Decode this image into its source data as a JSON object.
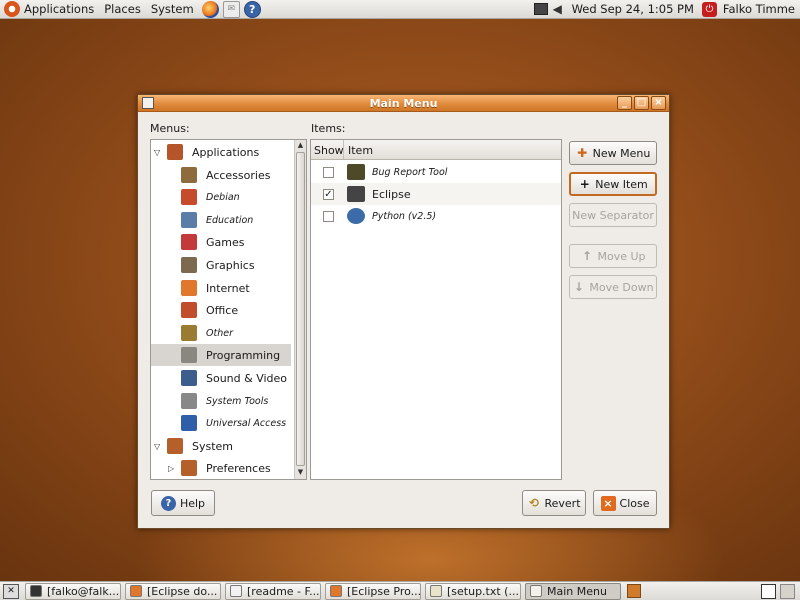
{
  "top_panel": {
    "menus": [
      "Applications",
      "Places",
      "System"
    ],
    "clock": "Wed Sep 24,  1:05 PM",
    "user": "Falko Timme",
    "launchers": [
      "firefox-icon",
      "mail-icon",
      "help-icon"
    ]
  },
  "dialog": {
    "title": "Main Menu",
    "menus_label": "Menus:",
    "items_label": "Items:",
    "tree": [
      {
        "label": "Applications",
        "level": 0,
        "expanded": true,
        "italic": false,
        "icon": "applications-icon",
        "color": "#b5562a"
      },
      {
        "label": "Accessories",
        "level": 1,
        "italic": false,
        "icon": "accessories-icon",
        "color": "#8d6b3d"
      },
      {
        "label": "Debian",
        "level": 1,
        "italic": true,
        "icon": "debian-icon",
        "color": "#c64b2b"
      },
      {
        "label": "Education",
        "level": 1,
        "italic": true,
        "icon": "education-icon",
        "color": "#5a7ea8"
      },
      {
        "label": "Games",
        "level": 1,
        "italic": false,
        "icon": "games-icon",
        "color": "#c23a3a"
      },
      {
        "label": "Graphics",
        "level": 1,
        "italic": false,
        "icon": "graphics-icon",
        "color": "#7d6a4e"
      },
      {
        "label": "Internet",
        "level": 1,
        "italic": false,
        "icon": "internet-icon",
        "color": "#e0772a"
      },
      {
        "label": "Office",
        "level": 1,
        "italic": false,
        "icon": "office-icon",
        "color": "#c04d2c"
      },
      {
        "label": "Other",
        "level": 1,
        "italic": true,
        "icon": "other-icon",
        "color": "#9a7b32"
      },
      {
        "label": "Programming",
        "level": 1,
        "italic": false,
        "selected": true,
        "icon": "programming-icon",
        "color": "#8a8780"
      },
      {
        "label": "Sound & Video",
        "level": 1,
        "italic": false,
        "icon": "sound-video-icon",
        "color": "#3d5e8c"
      },
      {
        "label": "System Tools",
        "level": 1,
        "italic": true,
        "icon": "system-tools-icon",
        "color": "#888888"
      },
      {
        "label": "Universal Access",
        "level": 1,
        "italic": true,
        "icon": "universal-access-icon",
        "color": "#2f5fa8"
      },
      {
        "label": "System",
        "level": 0,
        "expanded": true,
        "italic": false,
        "icon": "system-icon",
        "color": "#b55f2a"
      },
      {
        "label": "Preferences",
        "level": 1,
        "collapsed": true,
        "italic": false,
        "icon": "preferences-icon",
        "color": "#b55f2a"
      }
    ],
    "columns": {
      "show": "Show",
      "item": "Item"
    },
    "items": [
      {
        "label": "Bug Report Tool",
        "checked": false,
        "italic": true,
        "icon": "bug-icon",
        "color": "#4d4a2a"
      },
      {
        "label": "Eclipse",
        "checked": true,
        "italic": false,
        "icon": "eclipse-icon",
        "color": "#444444"
      },
      {
        "label": "Python (v2.5)",
        "checked": false,
        "italic": true,
        "icon": "python-icon",
        "color": "#3b6ca8"
      }
    ],
    "buttons": {
      "new_menu": "New Menu",
      "new_item": "New Item",
      "new_separator": "New Separator",
      "move_up": "Move Up",
      "move_down": "Move Down",
      "help": "Help",
      "revert": "Revert",
      "close": "Close"
    }
  },
  "taskbar": [
    {
      "label": "[falko@falk...",
      "active": false,
      "icon": "terminal-icon"
    },
    {
      "label": "[Eclipse do...",
      "active": false,
      "icon": "firefox-icon"
    },
    {
      "label": "[readme - F...",
      "active": false,
      "icon": "document-icon"
    },
    {
      "label": "[Eclipse Pro...",
      "active": false,
      "icon": "firefox-icon"
    },
    {
      "label": "[setup.txt (...",
      "active": false,
      "icon": "editor-icon"
    },
    {
      "label": "Main Menu",
      "active": true,
      "icon": "menu-editor-icon"
    }
  ],
  "colors": {
    "accent": "#e08b3e",
    "desktop": "#8d4918"
  }
}
